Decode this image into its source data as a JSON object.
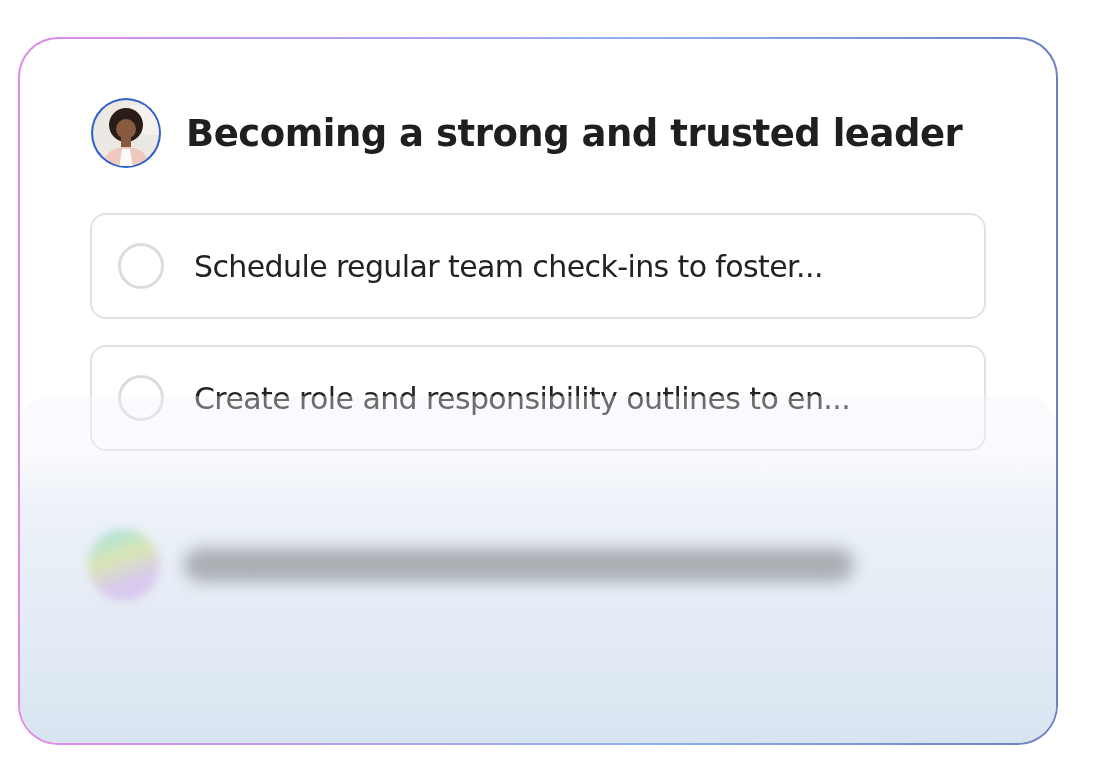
{
  "goal": {
    "title": "Becoming a strong and trusted leader"
  },
  "tasks": [
    {
      "text": "Schedule regular team check-ins to foster...",
      "checked": false
    },
    {
      "text": "Create role and responsibility outlines to en...",
      "checked": false
    }
  ]
}
